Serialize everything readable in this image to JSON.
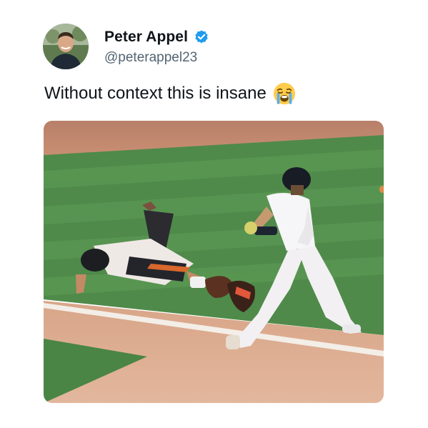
{
  "tweet": {
    "author": {
      "display_name": "Peter Appel",
      "handle": "@peterappel23",
      "verified": true,
      "avatar_icon": "user-avatar-photo"
    },
    "text": "Without context this is insane",
    "emoji": "loudly-crying-face-emoji",
    "media": {
      "type": "photo",
      "description_icon": "baseball-play-photo"
    }
  },
  "colors": {
    "verified_blue": "#1d9bf0",
    "text_primary": "#0f1419",
    "text_secondary": "#536471"
  }
}
